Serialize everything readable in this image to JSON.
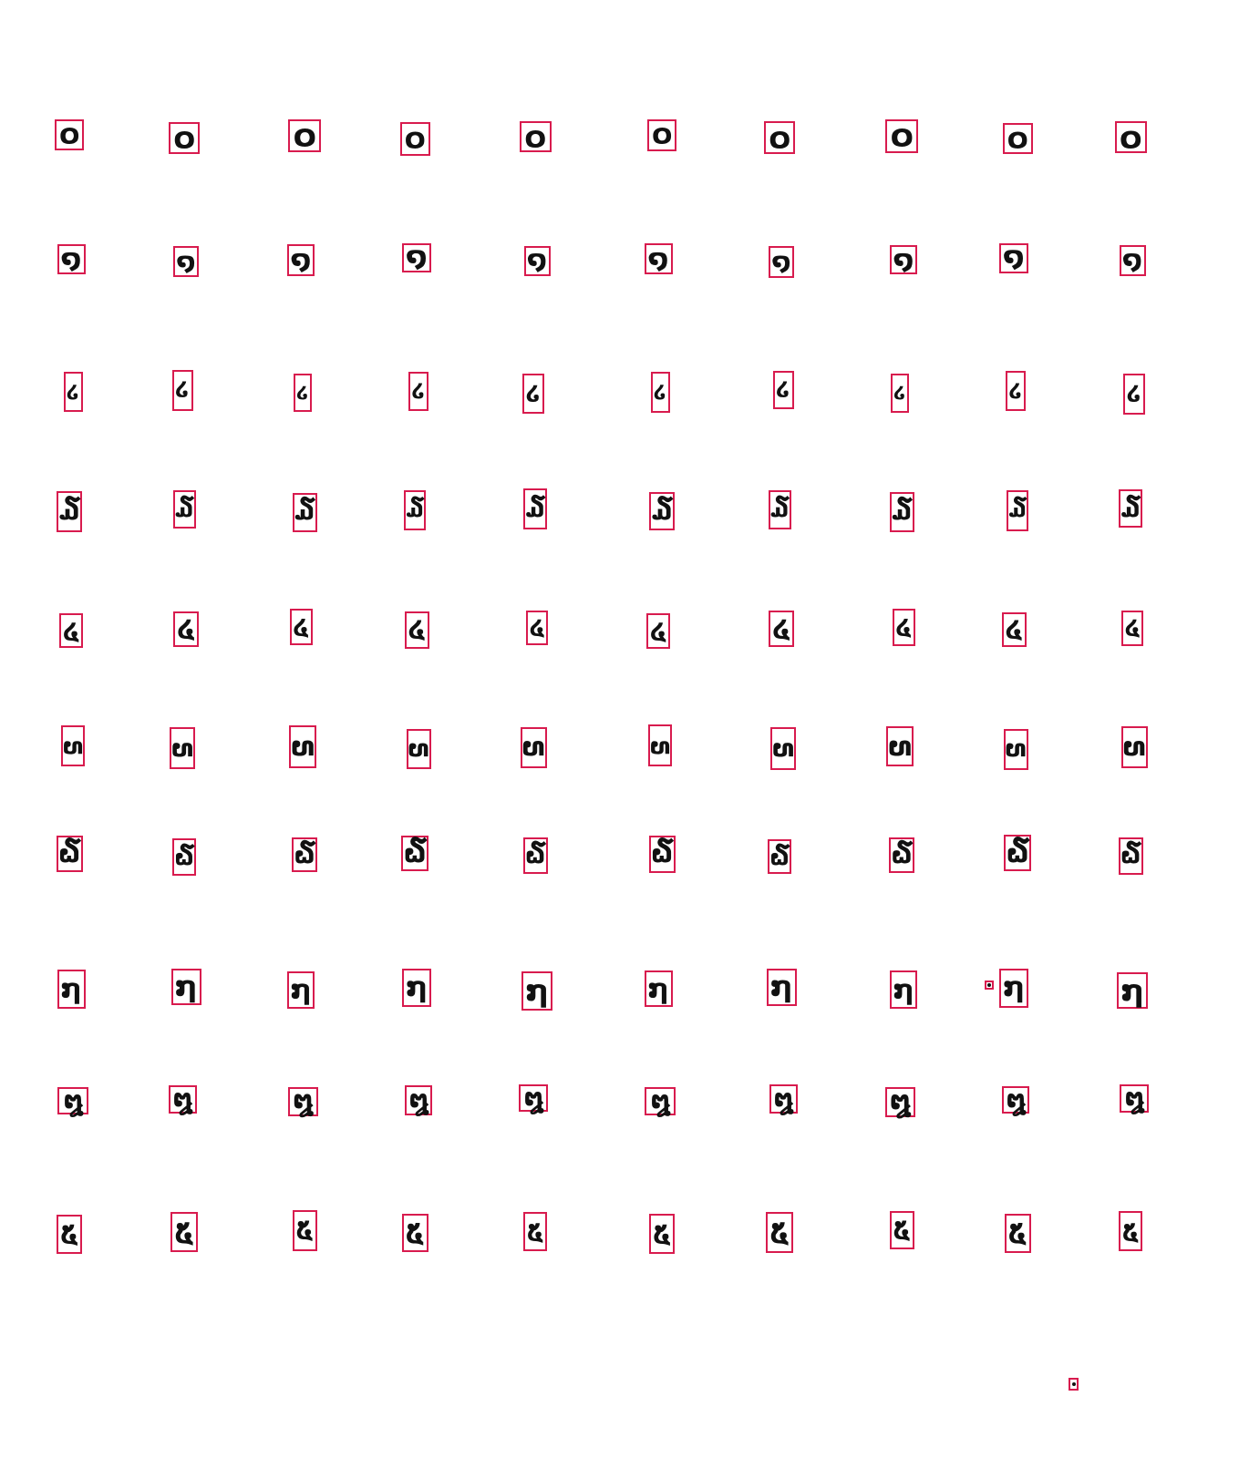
{
  "style": {
    "box_color": "#d81b4e",
    "ink_color": "#111111",
    "background": "#ffffff"
  },
  "rows": [
    {
      "glyph": "໐",
      "count": 10
    },
    {
      "glyph": "໑",
      "count": 10
    },
    {
      "glyph": "໒",
      "count": 10
    },
    {
      "glyph": "໓",
      "count": 10
    },
    {
      "glyph": "໔",
      "count": 10
    },
    {
      "glyph": "໙",
      "count": 10
    },
    {
      "glyph": "໖",
      "count": 10
    },
    {
      "glyph": "໗",
      "count": 10
    },
    {
      "glyph": "໘",
      "count": 10
    },
    {
      "glyph": "໕",
      "count": 10
    }
  ],
  "stray_marks": 2
}
